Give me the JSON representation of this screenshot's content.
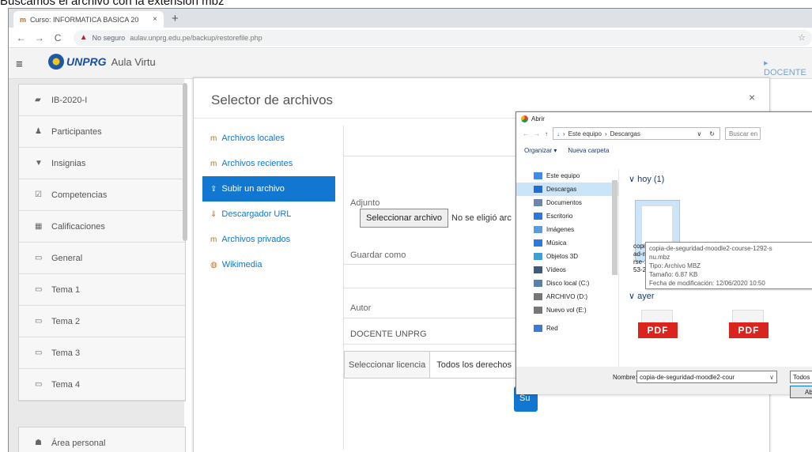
{
  "caption": "Buscamos el archivo con la extensión mbz",
  "browser": {
    "tab_title": "Curso: INFORMATICA BASICA 20",
    "tab_close": "×",
    "new_tab": "+",
    "back": "←",
    "forward": "→",
    "reload": "C",
    "insecure": "No seguro",
    "url": "aulav.unprg.edu.pe/backup/restorefile.php",
    "star": "☆"
  },
  "moodle": {
    "menu": "≡",
    "brand": "UNPRG",
    "aula": "Aula Virtu",
    "user": "▸ DOCENTE",
    "sidebar_top": [
      {
        "icon": "▰",
        "label": "IB-2020-I"
      },
      {
        "icon": "♟",
        "label": "Participantes"
      },
      {
        "icon": "▼",
        "label": "Insignias"
      },
      {
        "icon": "☑",
        "label": "Competencias"
      },
      {
        "icon": "▦",
        "label": "Calificaciones"
      },
      {
        "icon": "▭",
        "label": "General"
      },
      {
        "icon": "▭",
        "label": "Tema 1"
      },
      {
        "icon": "▭",
        "label": "Tema 2"
      },
      {
        "icon": "▭",
        "label": "Tema 3"
      },
      {
        "icon": "▭",
        "label": "Tema 4"
      }
    ],
    "sidebar_bottom": [
      {
        "icon": "☗",
        "label": "Área personal"
      }
    ]
  },
  "modal": {
    "title": "Selector de archivos",
    "close": "×",
    "repositories": [
      {
        "icon": "m",
        "label": "Archivos locales",
        "active": false
      },
      {
        "icon": "m",
        "label": "Archivos recientes",
        "active": false
      },
      {
        "icon": "⇪",
        "label": "Subir un archivo",
        "active": true
      },
      {
        "icon": "⇓",
        "label": "Descargador URL",
        "active": false
      },
      {
        "icon": "m",
        "label": "Archivos privados",
        "active": false
      },
      {
        "icon": "◍",
        "label": "Wikimedia",
        "active": false
      }
    ],
    "attachment_label": "Adjunto",
    "choose_file": "Seleccionar archivo",
    "no_file": "No se eligió arc",
    "save_as_label": "Guardar como",
    "author_label": "Autor",
    "author_value": "DOCENTE UNPRG",
    "license_label": "Seleccionar licencia",
    "license_value": "Todos los derechos",
    "upload_button": "Su"
  },
  "open_dialog": {
    "title": "Abrir",
    "back": "←",
    "forward": "→",
    "up": "↑",
    "path_1": "Este equipo",
    "path_2": "Descargas",
    "path_sep": "›",
    "dropdown": "∨",
    "refresh": "↻",
    "search": "Buscar en",
    "organize": "Organizar ▾",
    "new_folder": "Nueva carpeta",
    "tree": [
      {
        "label": "Este equipo",
        "color": "#3a8ee6",
        "selected": false
      },
      {
        "label": "Descargas",
        "color": "#1e6fd0",
        "selected": true
      },
      {
        "label": "Documentos",
        "color": "#6b86a8",
        "selected": false
      },
      {
        "label": "Escritorio",
        "color": "#2a7be0",
        "selected": false
      },
      {
        "label": "Imágenes",
        "color": "#5a9be0",
        "selected": false
      },
      {
        "label": "Música",
        "color": "#2a7be0",
        "selected": false
      },
      {
        "label": "Objetos 3D",
        "color": "#3aa0d8",
        "selected": false
      },
      {
        "label": "Vídeos",
        "color": "#3d5a80",
        "selected": false
      },
      {
        "label": "Disco local (C:)",
        "color": "#5a7fa8",
        "selected": false
      },
      {
        "label": "ARCHIVO (D:)",
        "color": "#777777",
        "selected": false
      },
      {
        "label": "Nuevo vol (E:)",
        "color": "#777777",
        "selected": false
      },
      {
        "label": "Red",
        "color": "#3a7bd5",
        "selected": false
      }
    ],
    "group_today": "∨ hoy (1)",
    "group_yesterday": "∨ ayer",
    "file_name_lines": [
      "copia",
      "ad-m",
      "rse-1",
      "53-20"
    ],
    "tooltip_lines": [
      "copia-de-seguridad-moodle2-course-1292-s",
      "nu.mbz",
      "Tipo: Archivo MBZ",
      "Tamaño: 6.87 KB",
      "Fecha de modificación: 12/06/2020 10:50"
    ],
    "pdf_label": "PDF",
    "name_label": "Nombre:",
    "name_value": "copia-de-seguridad-moodle2-cour",
    "filter": "Todos lo",
    "open_button": "Ab"
  }
}
